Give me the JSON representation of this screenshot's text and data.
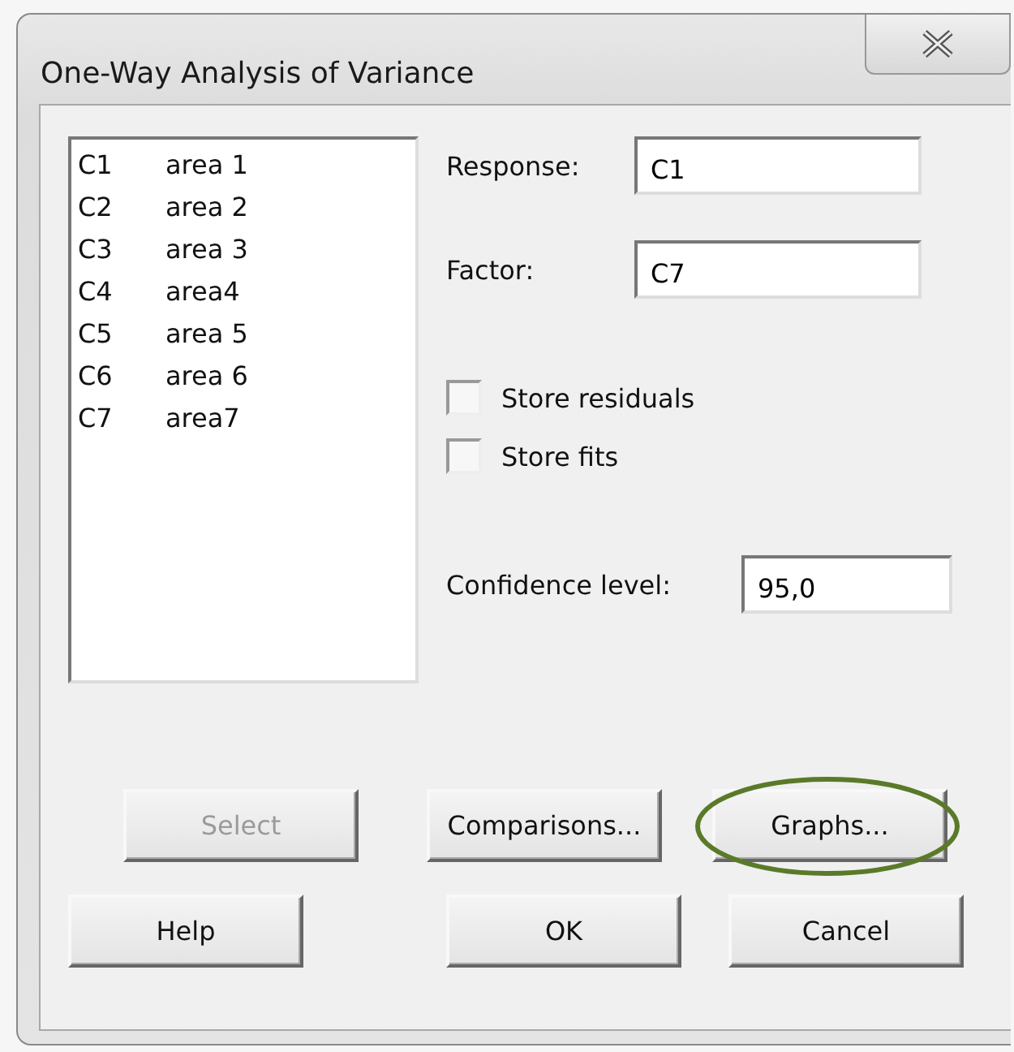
{
  "window": {
    "title": "One-Way Analysis of Variance"
  },
  "columns": [
    {
      "code": "C1",
      "name": "area 1"
    },
    {
      "code": "C2",
      "name": "area 2"
    },
    {
      "code": "C3",
      "name": "area 3"
    },
    {
      "code": "C4",
      "name": "area4"
    },
    {
      "code": "C5",
      "name": "area 5"
    },
    {
      "code": "C6",
      "name": "area 6"
    },
    {
      "code": "C7",
      "name": "area7"
    }
  ],
  "fields": [
    {
      "label": "Response:",
      "value": "C1"
    },
    {
      "label": "Factor:",
      "value": "C7"
    }
  ],
  "checkboxes": [
    {
      "label": "Store residuals",
      "checked": false
    },
    {
      "label": "Store fits",
      "checked": false
    }
  ],
  "confidence": {
    "label": "Confidence level:",
    "value": "95,0"
  },
  "button_rows": [
    [
      {
        "label": "Select",
        "disabled": true,
        "highlighted": false
      },
      {
        "label": "Comparisons...",
        "disabled": false,
        "highlighted": false
      },
      {
        "label": "Graphs...",
        "disabled": false,
        "highlighted": true
      }
    ],
    [
      {
        "label": "Help",
        "disabled": false,
        "highlighted": false
      },
      {
        "label": "OK",
        "disabled": false,
        "highlighted": false
      },
      {
        "label": "Cancel",
        "disabled": false,
        "highlighted": false
      }
    ]
  ]
}
